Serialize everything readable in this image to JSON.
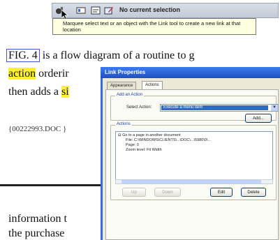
{
  "toolbar": {
    "status": "No current selection",
    "tooltip": "Marquee select text or an object with the Link tool to create a new link at that location"
  },
  "document": {
    "line1_link": "FIG. 4",
    "line1_rest": " is a flow diagram of a routine to g",
    "line2_hl": "action",
    "line2_rest": " orderir",
    "line3_pre": "then adds a ",
    "line3_hl": "si",
    "doc_ref": "{00222993.DOC }",
    "line4": "information t",
    "line5": "the purchase"
  },
  "dialog": {
    "title": "Link Properties",
    "tabs": [
      {
        "label": "Appearance"
      },
      {
        "label": "Actions"
      }
    ],
    "add_group": "Add an Action",
    "select_label": "Select Action:",
    "select_value": "Execute a menu item",
    "add_button": "Add...",
    "actions_group": "Actions",
    "tree": {
      "root": "Go to a page in another document",
      "file": "File: C:\\WINDOWS\\CLIENTS\\...\\DOC\\...\\5980\\0\\...",
      "page": "Page: 0",
      "zoom": "Zoom level: Fit Width"
    },
    "buttons": {
      "up": "Up",
      "down": "Down",
      "edit": "Edit",
      "delete": "Delete"
    }
  }
}
